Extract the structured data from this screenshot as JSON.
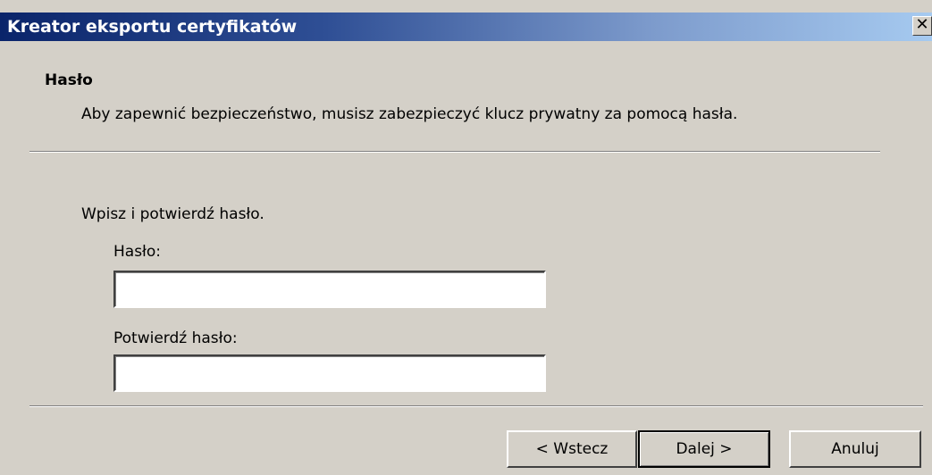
{
  "window": {
    "title": "Kreator eksportu certyfikatów",
    "close_symbol": "✕"
  },
  "header": {
    "title": "Hasło",
    "description": "Aby zapewnić bezpieczeństwo, musisz zabezpieczyć klucz prywatny za pomocą hasła."
  },
  "form": {
    "instruction": "Wpisz i potwierdź hasło.",
    "password_label": "Hasło:",
    "password_value": "",
    "confirm_label": "Potwierdź hasło:",
    "confirm_value": ""
  },
  "buttons": {
    "back": "< Wstecz",
    "next": "Dalej >",
    "cancel": "Anuluj"
  },
  "colors": {
    "titlebar_start": "#0a246a",
    "titlebar_end": "#a6caf0",
    "face": "#d4d0c8"
  }
}
